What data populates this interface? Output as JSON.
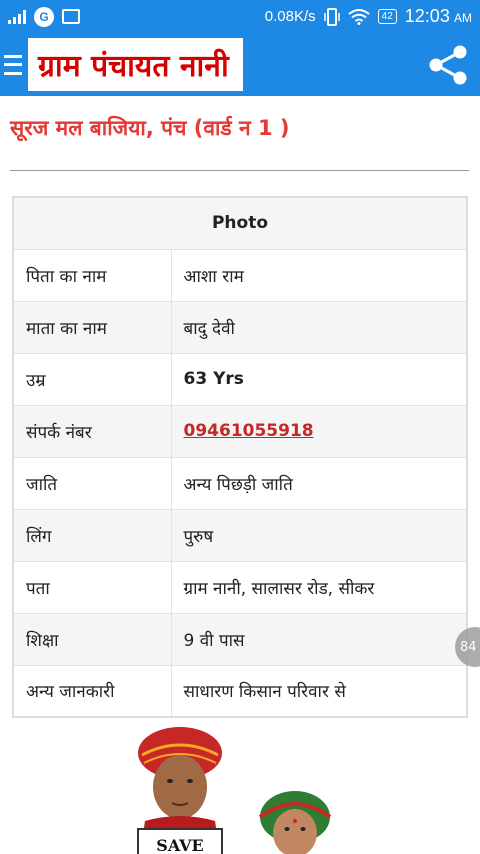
{
  "status_bar": {
    "network_speed": "0.08K/s",
    "battery": "42",
    "time": "12:03",
    "ampm": "AM"
  },
  "app_bar": {
    "title": "ग्राम पंचायत नानी"
  },
  "page": {
    "heading": "सूरज मल बाजिया, पंच (वार्ड न 1 )"
  },
  "table": {
    "photo_header": "Photo",
    "rows": [
      {
        "label": "पिता का नाम",
        "value": "आशा राम"
      },
      {
        "label": "माता का नाम",
        "value": "बादु देवी"
      },
      {
        "label": "उम्र",
        "value": "63 Yrs"
      },
      {
        "label": "संपर्क नंबर",
        "value": "09461055918"
      },
      {
        "label": "जाति",
        "value": "अन्य पिछड़ी जाति"
      },
      {
        "label": "लिंग",
        "value": "पुरुष"
      },
      {
        "label": "पता",
        "value": "ग्राम नानी, सालासर रोड, सीकर"
      },
      {
        "label": "शिक्षा",
        "value": "9 वी पास"
      },
      {
        "label": "अन्य जानकारी",
        "value": "साधारण किसान परिवार से"
      }
    ]
  },
  "floating_badge": "84",
  "banner_image": {
    "sign_text": "SAVE"
  },
  "colors": {
    "app_bar": "#1e88e5",
    "heading": "#e53935",
    "link": "#c62828"
  }
}
